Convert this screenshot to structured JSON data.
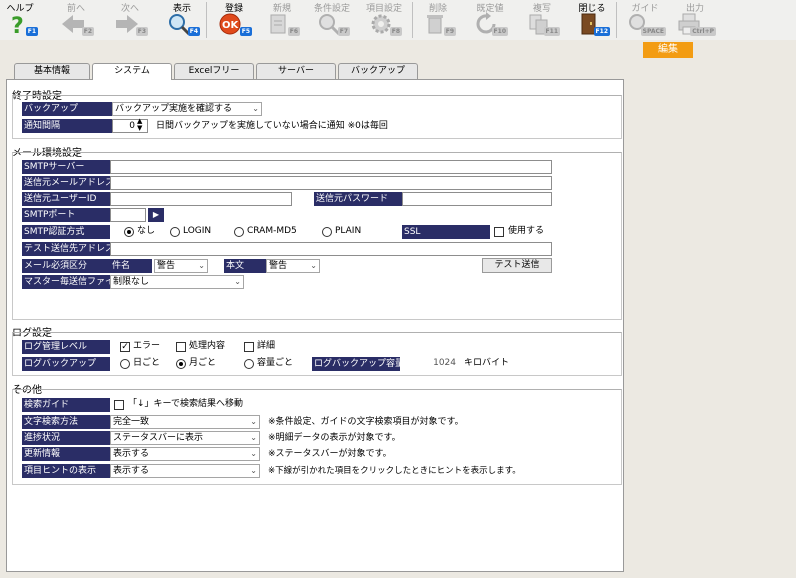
{
  "toolbar": {
    "help": {
      "label": "ヘルプ",
      "key": "F1"
    },
    "prev": {
      "label": "前へ",
      "key": "F2"
    },
    "next": {
      "label": "次へ",
      "key": "F3"
    },
    "show": {
      "label": "表示",
      "key": "F4"
    },
    "register": {
      "label": "登録",
      "key": "F5"
    },
    "new": {
      "label": "新規",
      "key": "F6"
    },
    "condition": {
      "label": "条件設定",
      "key": "F7"
    },
    "item_setting": {
      "label": "項目設定",
      "key": "F8"
    },
    "delete": {
      "label": "削除",
      "key": "F9"
    },
    "default": {
      "label": "既定値",
      "key": "F10"
    },
    "copy": {
      "label": "複写",
      "key": "F11"
    },
    "close": {
      "label": "閉じる",
      "key": "F12"
    },
    "guide": {
      "label": "ガイド",
      "key": "SPACE"
    },
    "output": {
      "label": "出力",
      "key": "Ctrl+P"
    }
  },
  "mode_badge": "編集",
  "tabs": [
    "基本情報",
    "システム",
    "Excelフリー",
    "サーバー",
    "バックアップ"
  ],
  "shutdown": {
    "title": "終了時設定",
    "backup_label": "バックアップ",
    "backup_value": "バックアップ実施を確認する",
    "notify_label": "通知間隔",
    "notify_value": "0",
    "notify_note": "日間バックアップを実施していない場合に通知 ※0は毎回"
  },
  "mail": {
    "title": "メール環境設定",
    "smtp_server_label": "SMTPサーバー",
    "smtp_server_value": "",
    "from_address_label": "送信元メールアドレス",
    "from_address_value": "",
    "from_user_label": "送信元ユーザーID",
    "from_user_value": "",
    "from_password_label": "送信元パスワード",
    "from_password_value": "",
    "smtp_port_label": "SMTPポート",
    "smtp_port_value": "",
    "auth_label": "SMTP認証方式",
    "auth_options": [
      "なし",
      "LOGIN",
      "CRAM-MD5",
      "PLAIN"
    ],
    "ssl_label": "SSL",
    "ssl_use": "使用する",
    "test_address_label": "テスト送信先アドレス",
    "test_address_value": "",
    "required_label": "メール必須区分",
    "subject_label": "件名",
    "subject_value": "警告",
    "body_label": "本文",
    "body_value": "警告",
    "test_send": "テスト送信",
    "master_label": "マスター毎送信ファイル",
    "master_value": "制限なし"
  },
  "log": {
    "title": "ログ設定",
    "level_label": "ログ管理レベル",
    "level_options": [
      "エラー",
      "処理内容",
      "詳細"
    ],
    "backup_label": "ログバックアップ",
    "backup_options": [
      "日ごと",
      "月ごと",
      "容量ごと"
    ],
    "capacity_label": "ログバックアップ容量",
    "capacity_value": "1024",
    "capacity_unit": "キロバイト"
  },
  "other": {
    "title": "その他",
    "search_guide_label": "検索ガイド",
    "search_guide_text": "「↓」キーで検索結果へ移動",
    "text_search_label": "文字検索方法",
    "text_search_value": "完全一致",
    "text_search_note": "※条件設定、ガイドの文字検索項目が対象です。",
    "progress_label": "進捗状況",
    "progress_value": "ステータスバーに表示",
    "progress_note": "※明細データの表示が対象です。",
    "update_label": "更新情報",
    "update_value": "表示する",
    "update_note": "※ステータスバーが対象です。",
    "hint_label": "項目ヒントの表示",
    "hint_value": "表示する",
    "hint_note": "※下線が引かれた項目をクリックしたときにヒントを表示します。"
  }
}
